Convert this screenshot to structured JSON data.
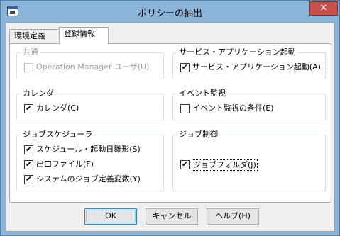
{
  "window": {
    "title": "ポリシーの抽出",
    "close_label": "✕"
  },
  "tabs": [
    {
      "label": "環境定義",
      "active": false
    },
    {
      "label": "登録情報",
      "active": true
    }
  ],
  "groups": {
    "common": {
      "label": "共通",
      "disabled": true,
      "items": [
        {
          "label": "Operation Manager ユーザ(U)",
          "checked": false,
          "disabled": true
        }
      ]
    },
    "service": {
      "label": "サービス・アプリケーション起動",
      "items": [
        {
          "label": "サービス・アプリケーション起動(A)",
          "checked": true
        }
      ]
    },
    "calendar": {
      "label": "カレンダ",
      "items": [
        {
          "label": "カレンダ(C)",
          "checked": true
        }
      ]
    },
    "event": {
      "label": "イベント監視",
      "items": [
        {
          "label": "イベント監視の条件(E)",
          "checked": false
        }
      ]
    },
    "scheduler": {
      "label": "ジョブスケジューラ",
      "items": [
        {
          "label": "スケジュール・起動日雛形(S)",
          "checked": true
        },
        {
          "label": "出口ファイル(F)",
          "checked": true
        },
        {
          "label": "システムのジョブ定義変数(Y)",
          "checked": true
        }
      ]
    },
    "jobctl": {
      "label": "ジョブ制御",
      "items": [
        {
          "label": "ジョブフォルダ(J)",
          "checked": true,
          "focused": true
        }
      ]
    }
  },
  "buttons": {
    "ok": "OK",
    "cancel": "キャンセル",
    "help": "ヘルプ(H)"
  },
  "check_glyph": "✔"
}
